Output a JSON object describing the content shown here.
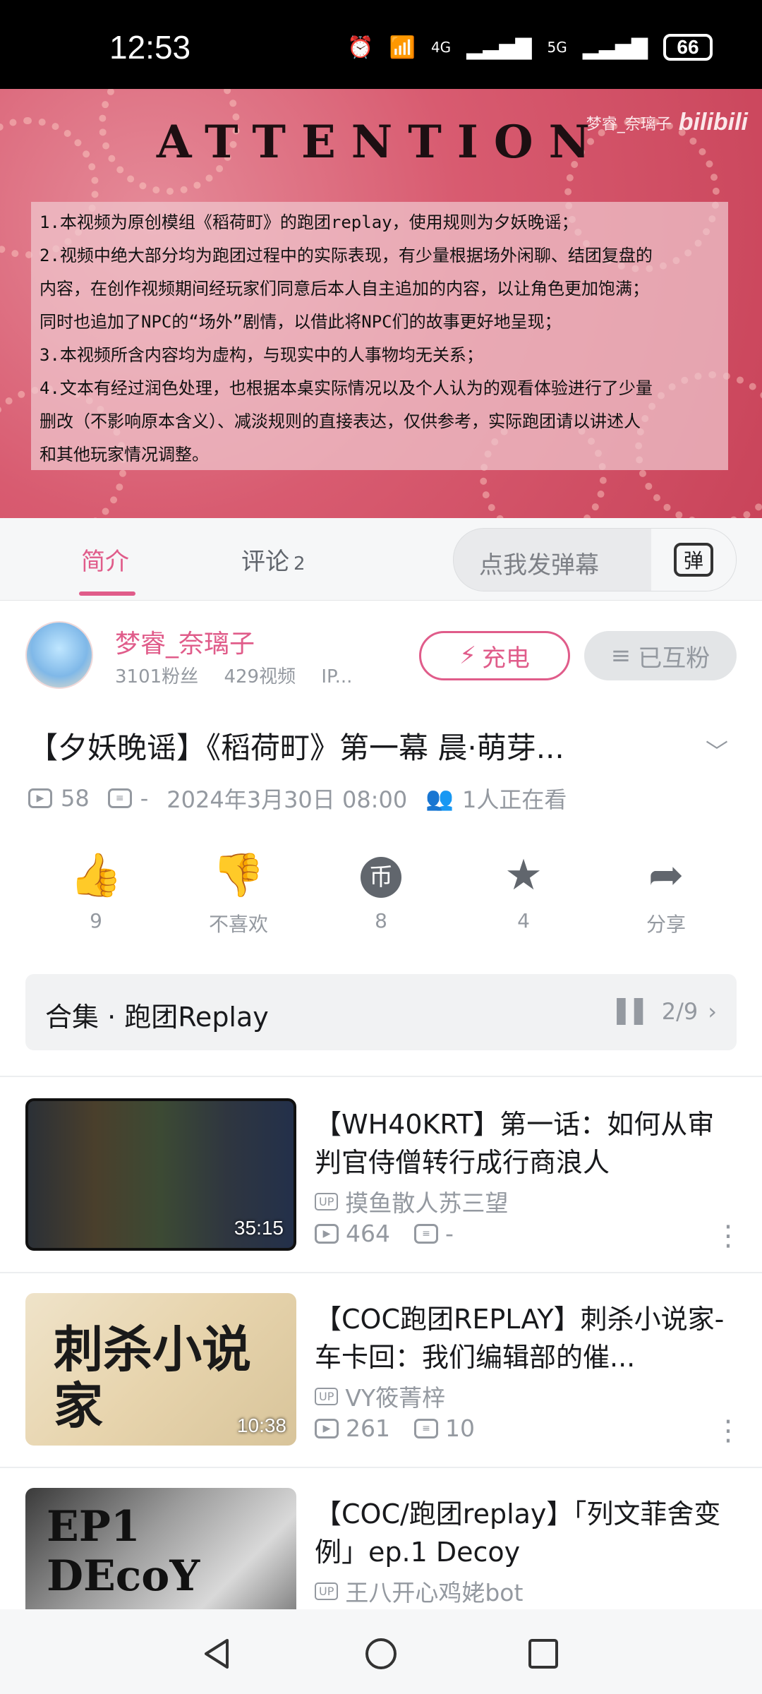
{
  "status_bar": {
    "time": "12:53",
    "battery": "66",
    "net1": "4G",
    "net2": "5G"
  },
  "banner": {
    "title": "ATTENTION",
    "watermark_name": "梦睿_奈璃子",
    "watermark_logo": "bilibili",
    "notice_lines": [
      "1.本视频为原创模组《稻荷町》的跑团replay，使用规则为夕妖晚谣；",
      "2.视频中绝大部分均为跑团过程中的实际表现，有少量根据场外闲聊、结团复盘的",
      "内容，在创作视频期间经玩家们同意后本人自主追加的内容，以让角色更加饱满；",
      "同时也追加了NPC的“场外”剧情，以借此将NPC们的故事更好地呈现；",
      "3.本视频所含内容均为虚构，与现实中的人事物均无关系；",
      "4.文本有经过润色处理，也根据本桌实际情况以及个人认为的观看体验进行了少量",
      "删改（不影响原本含义）、减淡规则的直接表达，仅供参考，实际跑团请以讲述人",
      "和其他玩家情况调整。"
    ]
  },
  "tabs": {
    "intro": "简介",
    "comments": "评论",
    "comments_count": "2"
  },
  "danmaku": {
    "placeholder": "点我发弹幕",
    "toggle_label": "弹"
  },
  "uploader": {
    "name": "梦睿_奈璃子",
    "fans": "3101粉丝",
    "videos": "429视频",
    "ip": "IP...",
    "charge_label": "充电",
    "follow_label": "已互粉"
  },
  "video": {
    "title": "【夕妖晚谣】《稻荷町》第一幕 晨·萌芽...",
    "plays": "58",
    "danmaku_count": "-",
    "date": "2024年3月30日 08:00",
    "watching": "1人正在看"
  },
  "actions": {
    "like": "9",
    "dislike": "不喜欢",
    "coin": "8",
    "favorite": "4",
    "share": "分享"
  },
  "collection": {
    "label": "合集 · 跑团Replay",
    "progress": "2/9"
  },
  "recommendations": [
    {
      "title": "【WH40KRT】第一话：如何从审判官侍僧转行成行商浪人",
      "uploader": "摸鱼散人苏三望",
      "plays": "464",
      "danmaku": "-",
      "duration": "35:15",
      "up_badge": "UP"
    },
    {
      "title": "【COC跑团REPLAY】刺杀小说家-车卡回：我们编辑部的催...",
      "uploader": "VY筱菁梓",
      "plays": "261",
      "danmaku": "10",
      "duration": "10:38",
      "up_badge": "UP",
      "thumb_text": "刺杀小说家"
    },
    {
      "title": "【COC/跑团replay】「列文菲舍变例」ep.1 Decoy",
      "uploader": "王八开心鸡姥bot",
      "plays": "",
      "danmaku": "",
      "duration": "",
      "up_badge": "UP",
      "thumb_text": "EP1 DEcoY"
    }
  ],
  "colors": {
    "accent": "#e05c8a",
    "banner": "#d85b70",
    "muted": "#9499a0"
  }
}
